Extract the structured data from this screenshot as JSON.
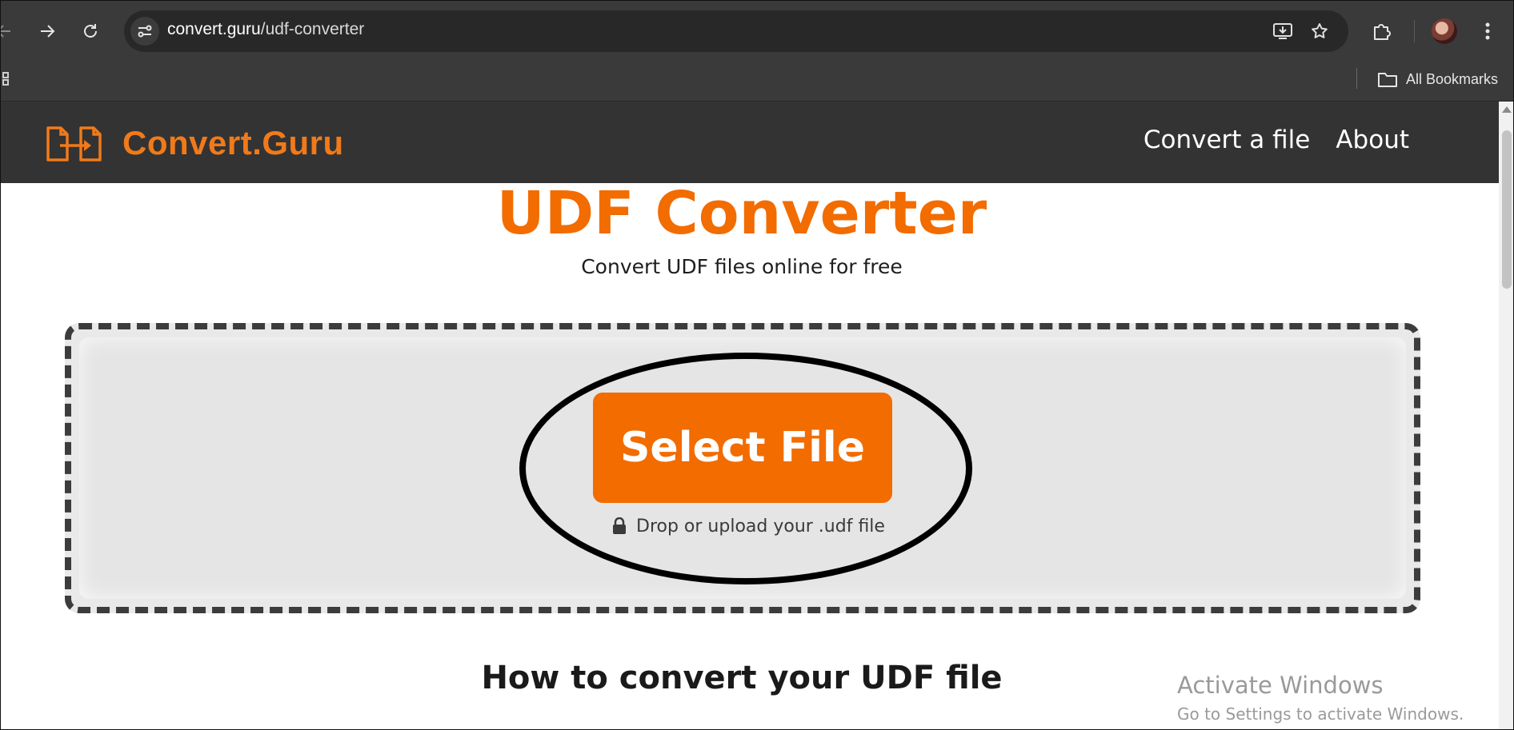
{
  "browser": {
    "url_host": "convert.guru",
    "url_path": "/udf-converter",
    "bookmarks_label": "All Bookmarks"
  },
  "site": {
    "brand_name": "Convert.Guru",
    "nav": {
      "convert": "Convert a file",
      "about": "About"
    }
  },
  "main": {
    "title": "UDF Converter",
    "subtitle": "Convert UDF files online for free",
    "upload": {
      "button_label": "Select File",
      "hint": "Drop or upload your .udf file"
    },
    "how_to_title": "How to convert your UDF file"
  },
  "watermark": {
    "title": "Activate Windows",
    "subtitle": "Go to Settings to activate Windows."
  },
  "colors": {
    "brand_orange": "#f26c00",
    "chrome_bg": "#3a3a3a",
    "header_bg": "#333333"
  },
  "icons": [
    "back-icon",
    "forward-icon",
    "reload-icon",
    "site-info-icon",
    "install-app-icon",
    "star-icon",
    "extensions-icon",
    "menu-icon",
    "apps-icon",
    "folder-icon",
    "lock-icon",
    "logo-icon"
  ]
}
